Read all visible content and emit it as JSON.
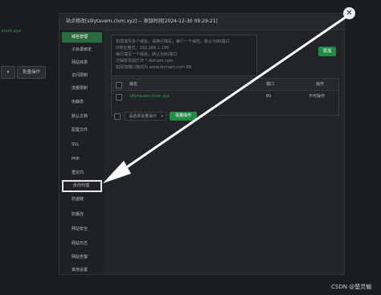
{
  "background": {
    "site_domain": "sillytavern.clvm.xyz",
    "site_domain_short": "clvm.xyz",
    "batch_button": "批量操作"
  },
  "modal": {
    "title": "站点修改[sillytavern.clvm.xyz] -- 添加时间[2024-12-30 09:29:21]",
    "close_icon": "close-icon",
    "sidebar": [
      {
        "label": "域名管理",
        "active": true
      },
      {
        "label": "子目录绑定"
      },
      {
        "label": "网站目录"
      },
      {
        "label": "访问限制"
      },
      {
        "label": "流量限制"
      },
      {
        "label": "伪静态"
      },
      {
        "label": "默认文档"
      },
      {
        "label": "配置文件"
      },
      {
        "label": "SSL"
      },
      {
        "label": "PHP"
      },
      {
        "label": "重定向"
      },
      {
        "label": "反向代理",
        "highlighted": true
      },
      {
        "label": "防盗链"
      },
      {
        "label": "防篡改"
      },
      {
        "label": "网站安全"
      },
      {
        "label": "网站日志"
      },
      {
        "label": "网站告警"
      },
      {
        "label": "其他设置"
      }
    ],
    "domain_input_placeholder": [
      "每行填写一个域名，默认为80端口",
      "泛解析添加方法 *.domain.com",
      "如另加端口格式为 www.domain.com:88"
    ],
    "domain_input_placeholder_head": "如需填写多个域名，请换行填写，每行一个域名，默认为80端口",
    "domain_input_placeholder_ip": "IP地址格式：192.168.1.199",
    "add_button": "添加",
    "table": {
      "headers": {
        "domain": "域名",
        "port": "端口",
        "action": "操作"
      },
      "rows": [
        {
          "domain": "sillytavern.clvm.xyz",
          "port": "80",
          "action": "不可操作"
        }
      ]
    },
    "batch_select_placeholder": "请选择批量操作",
    "batch_button": "批量操作"
  },
  "watermark": "CSDN @楚灵魈",
  "colors": {
    "accent": "#1f8b43",
    "link": "#2aa85a",
    "arrow": "#ffffff"
  }
}
